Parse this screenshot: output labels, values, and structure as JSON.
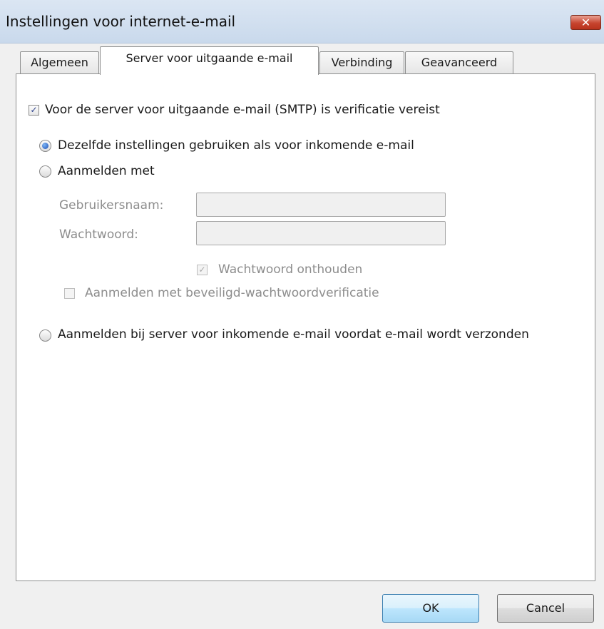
{
  "window": {
    "title": "Instellingen voor internet-e-mail",
    "close_glyph": "✕"
  },
  "tabs": [
    {
      "label": "Algemeen"
    },
    {
      "label": "Server voor uitgaande e-mail"
    },
    {
      "label": "Verbinding"
    },
    {
      "label": "Geavanceerd"
    }
  ],
  "active_tab": "Server voor uitgaande e-mail",
  "smtp": {
    "require_auth_label": "Voor de server voor uitgaande e-mail (SMTP) is verificatie vereist",
    "require_auth_checked": true,
    "option_same_label": "Dezelfde instellingen gebruiken als voor inkomende e-mail",
    "option_same_selected": true,
    "option_login_label": "Aanmelden met",
    "option_login_selected": false,
    "username_label": "Gebruikersnaam:",
    "username_value": "",
    "password_label": "Wachtwoord:",
    "password_value": "",
    "remember_password_label": "Wachtwoord onthouden",
    "remember_password_checked": true,
    "spa_label": "Aanmelden met beveiligd-wachtwoordverificatie",
    "spa_checked": false,
    "option_pop_label": "Aanmelden bij server voor inkomende e-mail voordat e-mail wordt verzonden",
    "option_pop_selected": false
  },
  "buttons": {
    "ok": "OK",
    "cancel": "Cancel"
  }
}
